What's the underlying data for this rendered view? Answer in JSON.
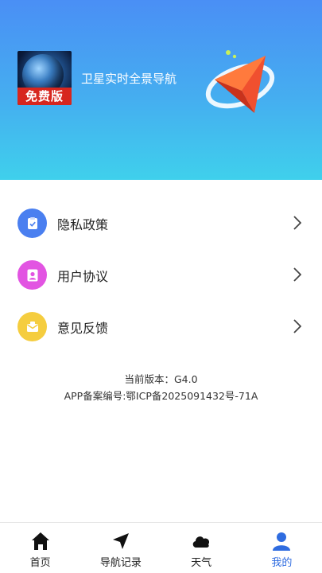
{
  "header": {
    "app_icon_badge": "免费版",
    "app_name": "卫星实时全景导航"
  },
  "menu": {
    "items": [
      {
        "label": "隐私政策",
        "icon": "clipboard-check-icon",
        "color": "#4a7ff0"
      },
      {
        "label": "用户协议",
        "icon": "user-icon",
        "color": "#e254e2"
      },
      {
        "label": "意见反馈",
        "icon": "mail-icon",
        "color": "#f5cd3f"
      }
    ]
  },
  "info": {
    "version": "当前版本：G4.0",
    "icp": "APP备案编号:鄂ICP备2025091432号-71A"
  },
  "tabbar": {
    "tabs": [
      {
        "label": "首页",
        "icon": "home-icon"
      },
      {
        "label": "导航记录",
        "icon": "navigation-arrow-icon"
      },
      {
        "label": "天气",
        "icon": "cloud-icon"
      },
      {
        "label": "我的",
        "icon": "person-icon"
      }
    ],
    "active_index": 3,
    "active_color": "#2f6ce0"
  }
}
